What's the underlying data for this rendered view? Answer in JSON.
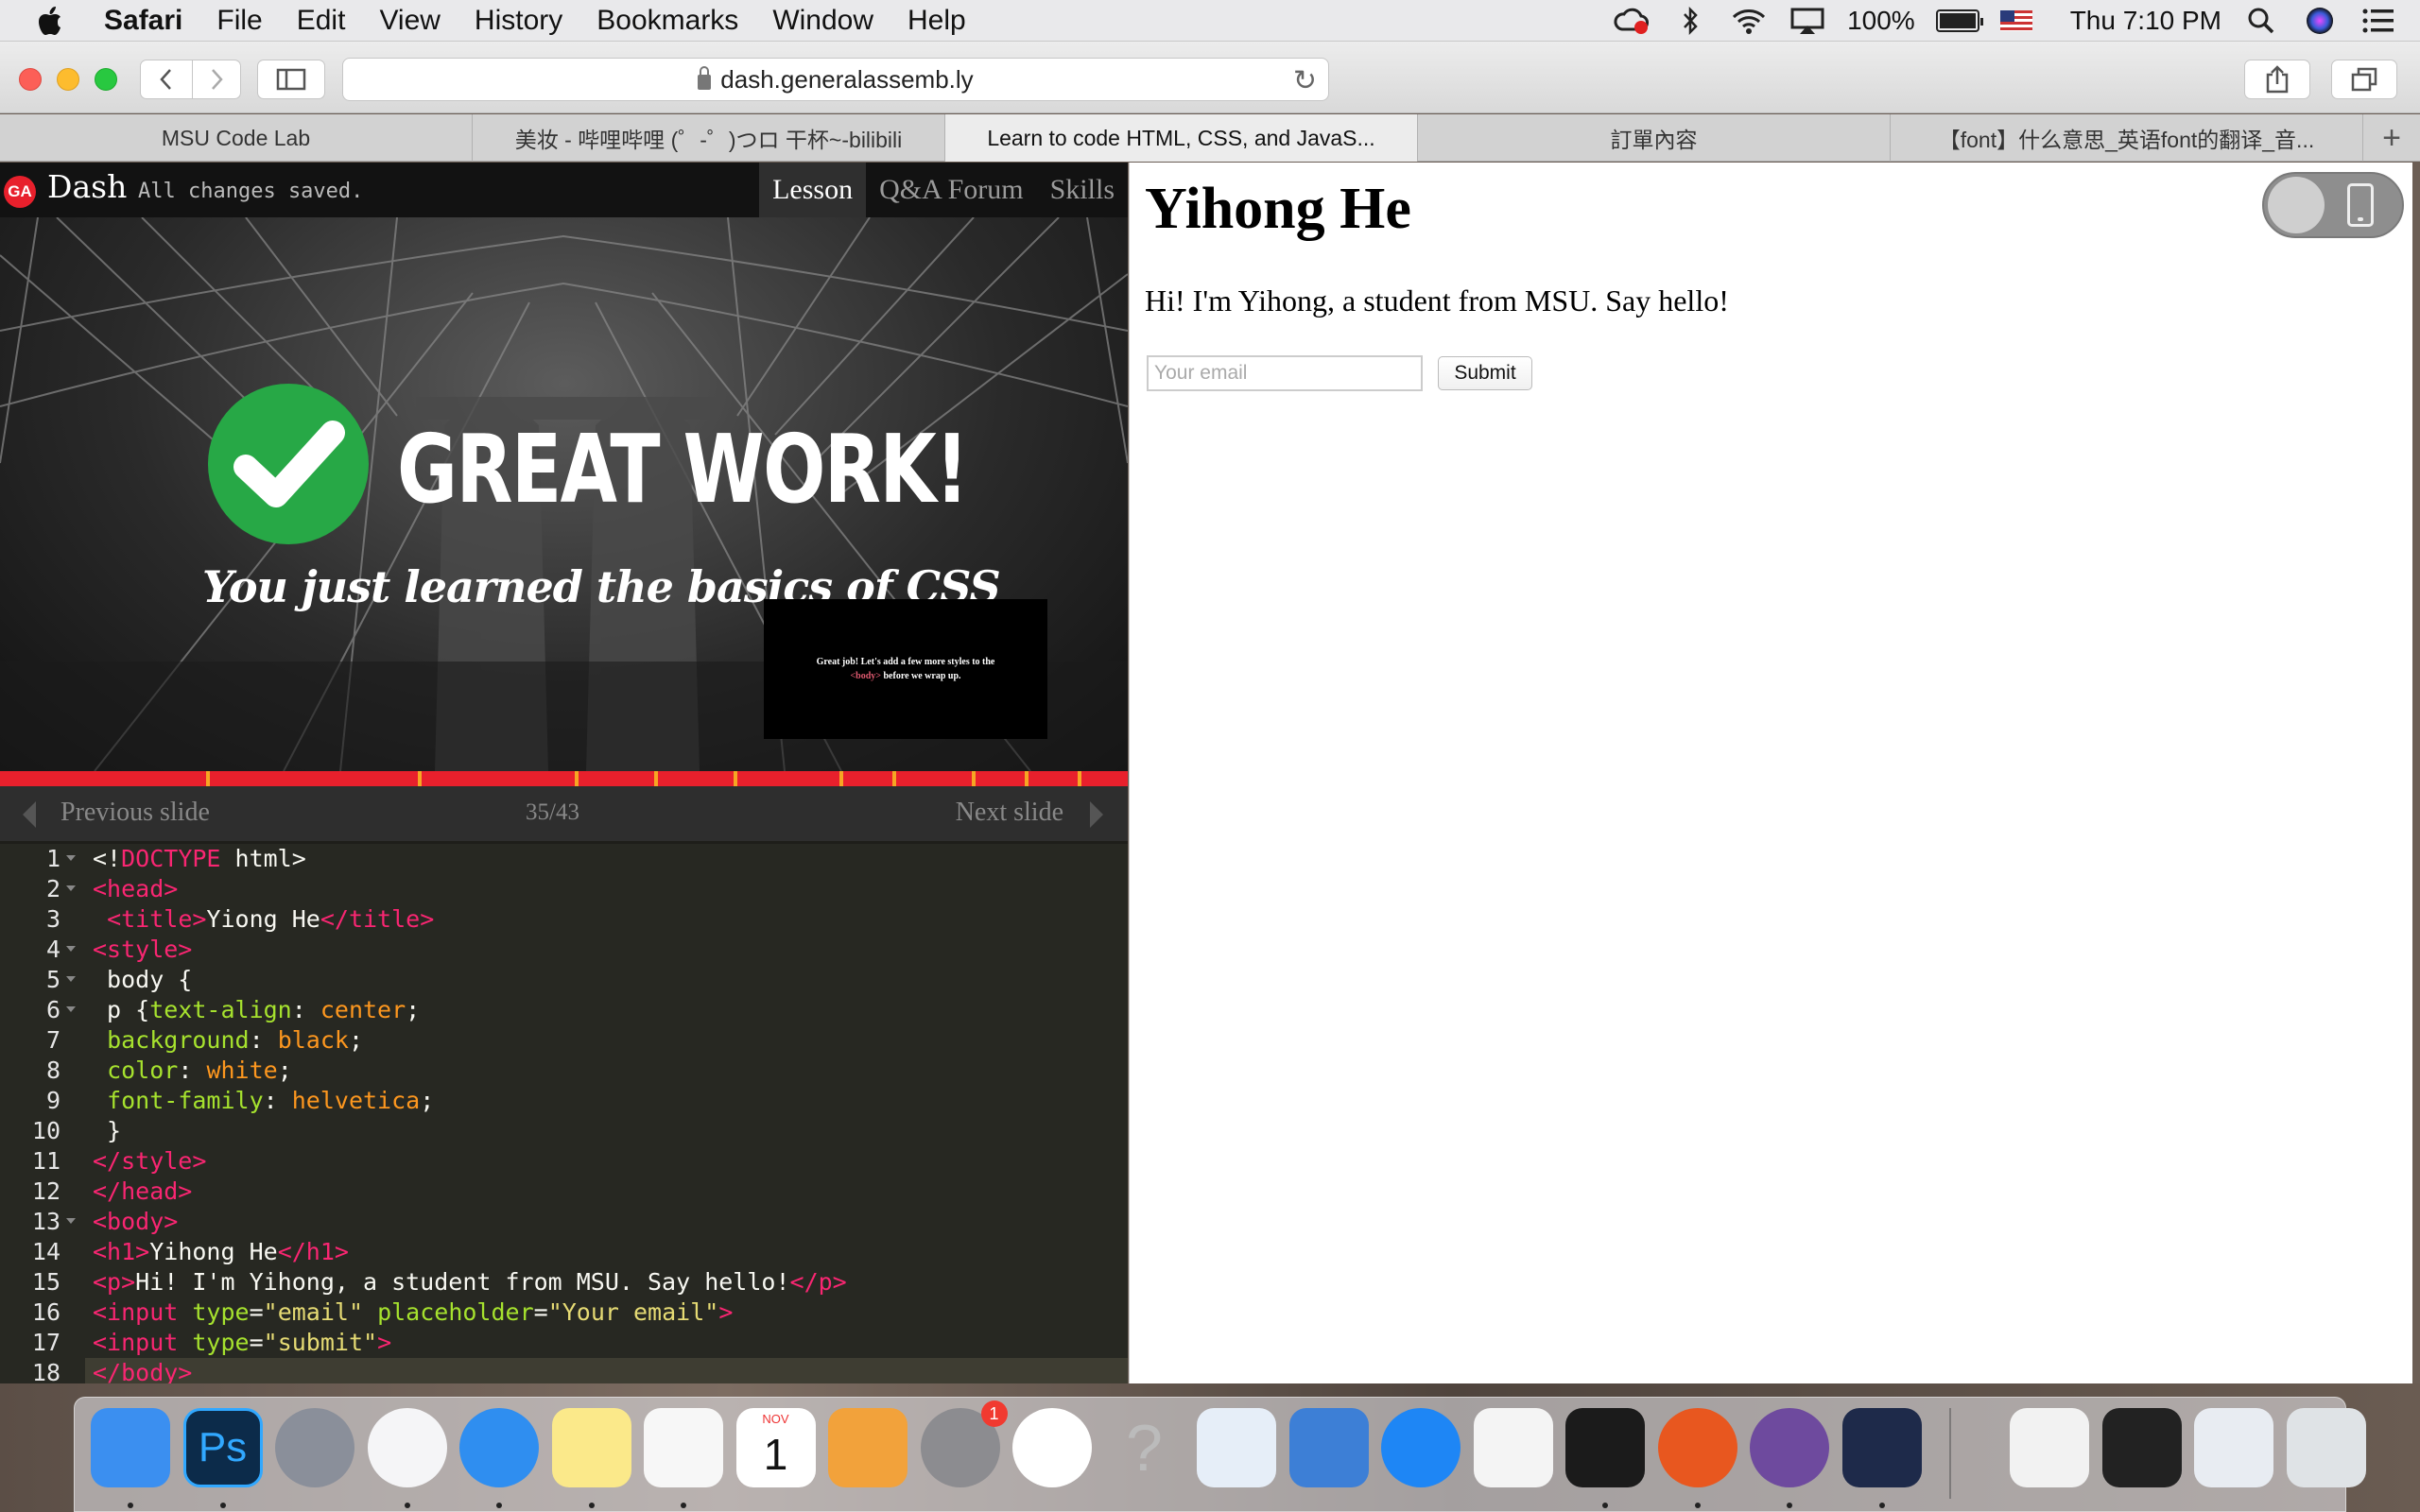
{
  "menubar": {
    "app": "Safari",
    "items": [
      "File",
      "Edit",
      "View",
      "History",
      "Bookmarks",
      "Window",
      "Help"
    ],
    "battery": "100%",
    "clock": "Thu 7:10 PM"
  },
  "toolbar": {
    "url": "dash.generalassemb.ly"
  },
  "tabs": [
    "MSU Code Lab",
    "美妆 - 哔哩哔哩 (゜-゜)つロ 干杯~-bilibili",
    "Learn to code HTML, CSS, and JavaS...",
    "訂單內容",
    "【font】什么意思_英语font的翻译_音...",
    "+"
  ],
  "dash": {
    "logo": "GA",
    "title": "Dash",
    "status": "All changes saved.",
    "nav": [
      "Lesson",
      "Q&A Forum",
      "Skills"
    ]
  },
  "slide": {
    "headline": "GREAT WORK!",
    "subline": "You just learned the basics of CSS",
    "popup_before": "Great job! Let's add a few more styles to the ",
    "popup_tag": "<body>",
    "popup_after": " before we wrap up.",
    "progress_fraction": 0.814,
    "prev": "Previous slide",
    "counter": "35/43",
    "next": "Next slide"
  },
  "editor": {
    "lines": [
      {
        "n": "1",
        "code": [
          [
            "w",
            "<!"
          ],
          [
            "t",
            "DOCTYPE"
          ],
          [
            "w",
            " html>"
          ]
        ]
      },
      {
        "n": "2",
        "code": [
          [
            "t",
            "<head>"
          ]
        ]
      },
      {
        "n": "3",
        "code": [
          [
            "w",
            " "
          ],
          [
            "t",
            "<title>"
          ],
          [
            "w",
            "Yiong He"
          ],
          [
            "t",
            "</title>"
          ]
        ]
      },
      {
        "n": "4",
        "code": [
          [
            "t",
            "<style>"
          ]
        ]
      },
      {
        "n": "5",
        "code": [
          [
            "w",
            " body {"
          ]
        ]
      },
      {
        "n": "6",
        "code": [
          [
            "w",
            " p {"
          ],
          [
            "a",
            "text-align"
          ],
          [
            "w",
            ": "
          ],
          [
            "p",
            "center"
          ],
          [
            "w",
            ";"
          ]
        ]
      },
      {
        "n": "7",
        "code": [
          [
            "w",
            " "
          ],
          [
            "a",
            "background"
          ],
          [
            "w",
            ": "
          ],
          [
            "p",
            "black"
          ],
          [
            "w",
            ";"
          ]
        ]
      },
      {
        "n": "8",
        "code": [
          [
            "w",
            " "
          ],
          [
            "a",
            "color"
          ],
          [
            "w",
            ": "
          ],
          [
            "p",
            "white"
          ],
          [
            "w",
            ";"
          ]
        ]
      },
      {
        "n": "9",
        "code": [
          [
            "w",
            " "
          ],
          [
            "a",
            "font-family"
          ],
          [
            "w",
            ": "
          ],
          [
            "p",
            "helvetica"
          ],
          [
            "w",
            ";"
          ]
        ]
      },
      {
        "n": "10",
        "code": [
          [
            "w",
            " }"
          ]
        ]
      },
      {
        "n": "11",
        "code": [
          [
            "t",
            "</style>"
          ]
        ]
      },
      {
        "n": "12",
        "code": [
          [
            "t",
            "</head>"
          ]
        ]
      },
      {
        "n": "13",
        "code": [
          [
            "t",
            "<body>"
          ]
        ]
      },
      {
        "n": "14",
        "code": [
          [
            "t",
            "<h1>"
          ],
          [
            "w",
            "Yihong He"
          ],
          [
            "t",
            "</h1>"
          ]
        ]
      },
      {
        "n": "15",
        "code": [
          [
            "t",
            "<p>"
          ],
          [
            "w",
            "Hi! I'm Yihong, a student from MSU. Say hello!"
          ],
          [
            "t",
            "</p>"
          ]
        ]
      },
      {
        "n": "16",
        "code": [
          [
            "t",
            "<input "
          ],
          [
            "a",
            "type"
          ],
          [
            "w",
            "="
          ],
          [
            "s",
            "\"email\""
          ],
          [
            "w",
            " "
          ],
          [
            "a",
            "placeholder"
          ],
          [
            "w",
            "="
          ],
          [
            "s",
            "\"Your email\""
          ],
          [
            "t",
            ">"
          ]
        ]
      },
      {
        "n": "17",
        "code": [
          [
            "t",
            "<input "
          ],
          [
            "a",
            "type"
          ],
          [
            "w",
            "="
          ],
          [
            "s",
            "\"submit\""
          ],
          [
            "t",
            ">"
          ]
        ]
      },
      {
        "n": "18",
        "code": [
          [
            "t",
            "</body>"
          ]
        ]
      }
    ]
  },
  "preview": {
    "heading": "Yihong He",
    "paragraph": "Hi! I'm Yihong, a student from MSU. Say hello!",
    "email_placeholder": "Your email",
    "submit_label": "Submit"
  },
  "dock": {
    "apps": [
      "finder",
      "photoshop",
      "launchpad",
      "itunes",
      "safari",
      "notes",
      "reminders",
      "calendar",
      "pages",
      "system-preferences",
      "photos",
      "help",
      "preview",
      "keynote",
      "app-store",
      "numbers",
      "terminal",
      "firefox",
      "github-desktop",
      "infuse",
      "window-1",
      "window-2",
      "window-3",
      "trash"
    ],
    "calendar_month": "NOV",
    "calendar_day": "1",
    "sysprefs_badge": "1"
  },
  "colors": {
    "accent_red": "#e8202c",
    "check_green": "#27a846",
    "progress_tick": "#f6a623"
  }
}
